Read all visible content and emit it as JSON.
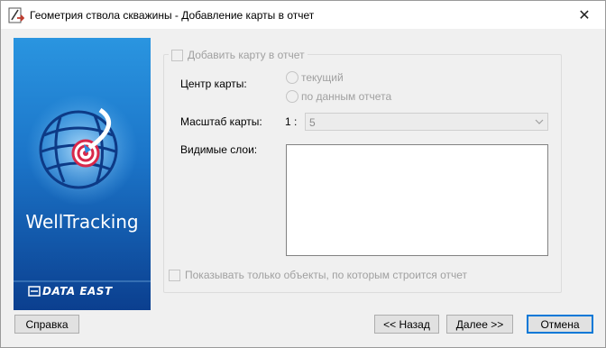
{
  "window": {
    "title": "Геометрия ствола скважины - Добавление карты в отчет",
    "close_glyph": "✕"
  },
  "banner": {
    "product_name": "WellTracking",
    "brand": "DATA EAST",
    "colors": {
      "background_top": "#1f7fd0",
      "background_bottom": "#0a3e8c",
      "accent": "#d8284a"
    }
  },
  "form": {
    "add_map_label": "Добавить карту в отчет",
    "add_map_checked": false,
    "map_center_label": "Центр карты:",
    "center_options": [
      {
        "label": "текущий",
        "selected": false
      },
      {
        "label": "по данным отчета",
        "selected": false
      }
    ],
    "scale_label": "Масштаб карты:",
    "scale_prefix": "1 :",
    "scale_value": "5",
    "visible_layers_label": "Видимые слои:",
    "visible_layers": [],
    "show_only_label": "Показывать только объекты, по которым строится отчет",
    "show_only_checked": false
  },
  "buttons": {
    "help": "Справка",
    "back": "<< Назад",
    "next": "Далее >>",
    "cancel": "Отмена"
  }
}
